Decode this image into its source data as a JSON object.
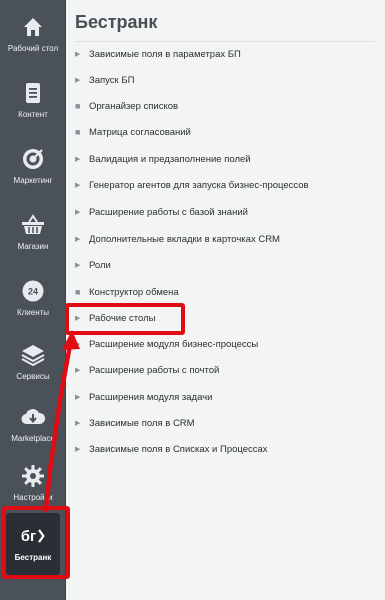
{
  "sidebar": {
    "items": [
      {
        "label": "Рабочий стол",
        "icon": "home-icon"
      },
      {
        "label": "Контент",
        "icon": "document-icon"
      },
      {
        "label": "Маркетинг",
        "icon": "target-icon"
      },
      {
        "label": "Магазин",
        "icon": "basket-icon"
      },
      {
        "label": "Клиенты",
        "icon": "clock-24-icon",
        "icon_text": "24"
      },
      {
        "label": "Сервисы",
        "icon": "layers-icon"
      },
      {
        "label": "Marketplace",
        "icon": "cloud-download-icon"
      },
      {
        "label": "Настройки",
        "icon": "gear-icon"
      },
      {
        "label": "Бестранк",
        "icon": "bestrank-logo-icon",
        "icon_text": "бг",
        "active": true
      }
    ]
  },
  "main": {
    "title": "Бестранк",
    "menu": [
      {
        "label": "Зависимые поля в параметрах БП",
        "bullet": "arrow"
      },
      {
        "label": "Запуск БП",
        "bullet": "arrow"
      },
      {
        "label": "Органайзер списков",
        "bullet": "dot"
      },
      {
        "label": "Матрица согласований",
        "bullet": "dot"
      },
      {
        "label": "Валидация и предзаполнение полей",
        "bullet": "arrow"
      },
      {
        "label": "Генератор агентов для запуска бизнес-процессов",
        "bullet": "arrow"
      },
      {
        "label": "Расширение работы с базой знаний",
        "bullet": "arrow"
      },
      {
        "label": "Дополнительные вкладки в карточках CRM",
        "bullet": "arrow"
      },
      {
        "label": "Роли",
        "bullet": "arrow"
      },
      {
        "label": "Конструктор обмена",
        "bullet": "dot"
      },
      {
        "label": "Рабочие столы",
        "bullet": "arrow",
        "highlighted": true
      },
      {
        "label": "Расширение модуля бизнес-процессы",
        "bullet": "arrow"
      },
      {
        "label": "Расширение работы с почтой",
        "bullet": "arrow"
      },
      {
        "label": "Расширения модуля задачи",
        "bullet": "arrow"
      },
      {
        "label": "Зависимые поля в CRM",
        "bullet": "arrow"
      },
      {
        "label": "Зависимые поля в Списках и Процессах",
        "bullet": "arrow"
      }
    ]
  },
  "glyphs": {
    "arrow": "▶",
    "dot": "■"
  },
  "colors": {
    "sidebar_bg": "#4a5159",
    "active_bg": "#2a2f35",
    "highlight": "#e10b14"
  }
}
